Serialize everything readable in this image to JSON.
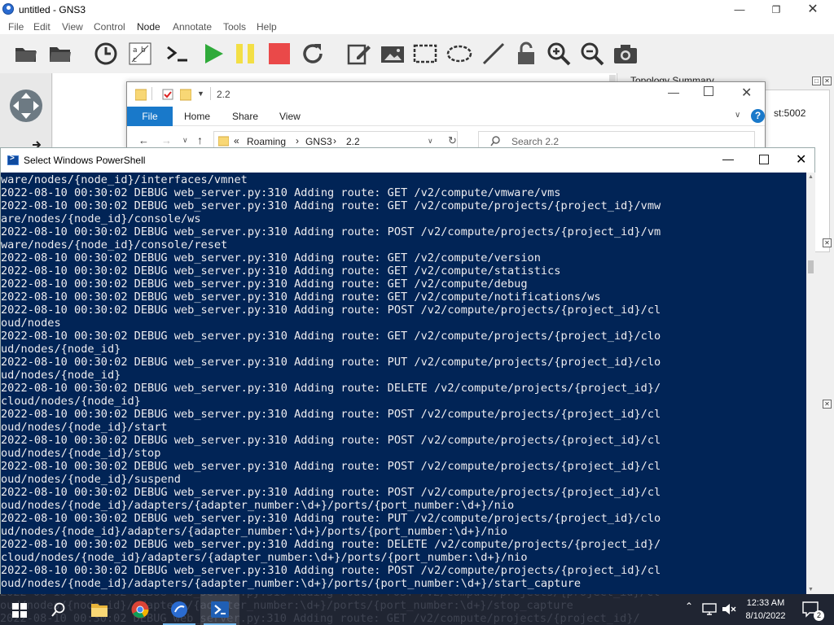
{
  "gns3": {
    "window_title": "untitled - GNS3",
    "menu": [
      "File",
      "Edit",
      "View",
      "Control",
      "Node",
      "Annotate",
      "Tools",
      "Help"
    ],
    "topology_summary_label": "Topology Summary",
    "server_label": "st:5002"
  },
  "explorer": {
    "title_path": "2.2",
    "ribbon_tabs": {
      "file": "File",
      "home": "Home",
      "share": "Share",
      "view": "View"
    },
    "breadcrumb": {
      "prefix": "«",
      "items": [
        "Roaming",
        "GNS3",
        "2.2"
      ],
      "separator": "›"
    },
    "search_placeholder": "Search 2.2"
  },
  "powershell": {
    "title": "Select Windows PowerShell",
    "lines": [
      "ware/nodes/{node_id}/interfaces/vmnet",
      "2022-08-10 00:30:02 DEBUG web_server.py:310 Adding route: GET /v2/compute/vmware/vms",
      "2022-08-10 00:30:02 DEBUG web_server.py:310 Adding route: GET /v2/compute/projects/{project_id}/vmw",
      "are/nodes/{node_id}/console/ws",
      "2022-08-10 00:30:02 DEBUG web_server.py:310 Adding route: POST /v2/compute/projects/{project_id}/vm",
      "ware/nodes/{node_id}/console/reset",
      "2022-08-10 00:30:02 DEBUG web_server.py:310 Adding route: GET /v2/compute/version",
      "2022-08-10 00:30:02 DEBUG web_server.py:310 Adding route: GET /v2/compute/statistics",
      "2022-08-10 00:30:02 DEBUG web_server.py:310 Adding route: GET /v2/compute/debug",
      "2022-08-10 00:30:02 DEBUG web_server.py:310 Adding route: GET /v2/compute/notifications/ws",
      "2022-08-10 00:30:02 DEBUG web_server.py:310 Adding route: POST /v2/compute/projects/{project_id}/cl",
      "oud/nodes",
      "2022-08-10 00:30:02 DEBUG web_server.py:310 Adding route: GET /v2/compute/projects/{project_id}/clo",
      "ud/nodes/{node_id}",
      "2022-08-10 00:30:02 DEBUG web_server.py:310 Adding route: PUT /v2/compute/projects/{project_id}/clo",
      "ud/nodes/{node_id}",
      "2022-08-10 00:30:02 DEBUG web_server.py:310 Adding route: DELETE /v2/compute/projects/{project_id}/",
      "cloud/nodes/{node_id}",
      "2022-08-10 00:30:02 DEBUG web_server.py:310 Adding route: POST /v2/compute/projects/{project_id}/cl",
      "oud/nodes/{node_id}/start",
      "2022-08-10 00:30:02 DEBUG web_server.py:310 Adding route: POST /v2/compute/projects/{project_id}/cl",
      "oud/nodes/{node_id}/stop",
      "2022-08-10 00:30:02 DEBUG web_server.py:310 Adding route: POST /v2/compute/projects/{project_id}/cl",
      "oud/nodes/{node_id}/suspend",
      "2022-08-10 00:30:02 DEBUG web_server.py:310 Adding route: POST /v2/compute/projects/{project_id}/cl",
      "oud/nodes/{node_id}/adapters/{adapter_number:\\d+}/ports/{port_number:\\d+}/nio",
      "2022-08-10 00:30:02 DEBUG web_server.py:310 Adding route: PUT /v2/compute/projects/{project_id}/clo",
      "ud/nodes/{node_id}/adapters/{adapter_number:\\d+}/ports/{port_number:\\d+}/nio",
      "2022-08-10 00:30:02 DEBUG web_server.py:310 Adding route: DELETE /v2/compute/projects/{project_id}/",
      "cloud/nodes/{node_id}/adapters/{adapter_number:\\d+}/ports/{port_number:\\d+}/nio",
      "2022-08-10 00:30:02 DEBUG web_server.py:310 Adding route: POST /v2/compute/projects/{project_id}/cl",
      "oud/nodes/{node_id}/adapters/{adapter_number:\\d+}/ports/{port_number:\\d+}/start_capture"
    ],
    "hidden_lines": [
      "2022-08-10 00:30:02 DEBUG web_server.py:310 Adding route: POST /v2/compute/projects/{project_id}/cl",
      "oud/nodes/{node_id}/adapters/{adapter_number:\\d+}/ports/{port_number:\\d+}/stop_capture",
      "2022-08-10 00:30:02 DEBUG web_server.py:310 Adding route: GET /v2/compute/projects/{project_id}/"
    ]
  },
  "taskbar": {
    "time": "12:33 AM",
    "date": "8/10/2022",
    "notification_count": "2"
  },
  "colors": {
    "powershell_bg": "#012456",
    "powershell_text": "#eeedf0",
    "explorer_file_tab": "#1979ca",
    "taskbar_bg": "#0e1422"
  }
}
